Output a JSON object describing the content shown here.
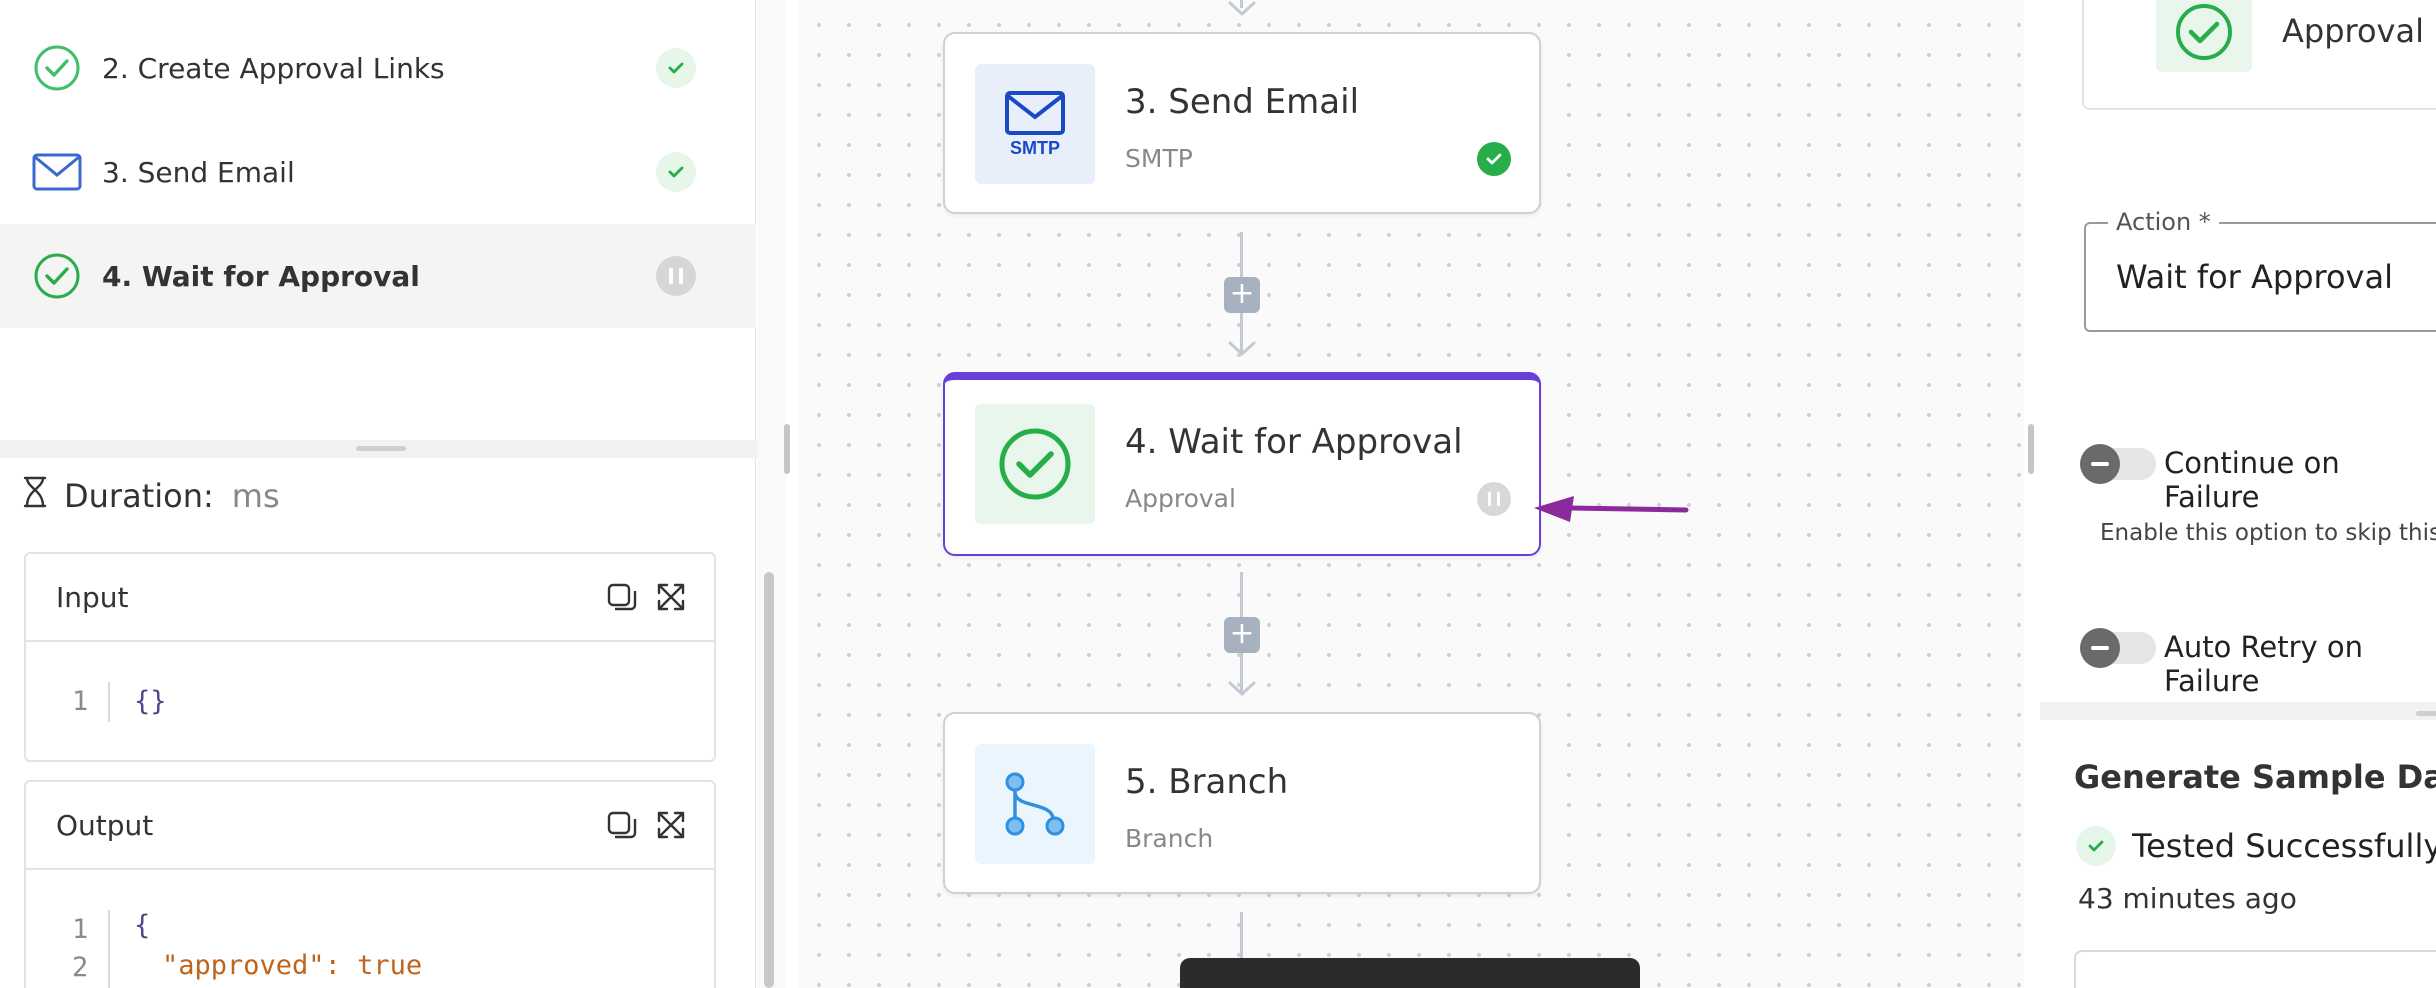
{
  "colors": {
    "success_green": "#27ae4a",
    "smtp_blue": "#1a49c6",
    "branch_blue": "#2f8fe0",
    "selected_purple": "#6a3fd8",
    "annotation_arrow": "#8b2a9a"
  },
  "steps_list": [
    {
      "label": "2. Create Approval Links",
      "icon": "check-circle-icon",
      "status": "success"
    },
    {
      "label": "3. Send Email",
      "icon": "mail-icon",
      "status": "success"
    },
    {
      "label": "4. Wait for Approval",
      "icon": "check-circle-icon",
      "status": "paused"
    }
  ],
  "run_details": {
    "duration_label": "Duration:",
    "duration_unit": "ms",
    "input": {
      "title": "Input",
      "lines": [
        {
          "num": "1",
          "text": "{}"
        }
      ]
    },
    "output": {
      "title": "Output",
      "lines": [
        {
          "num": "1",
          "text": "{"
        },
        {
          "num": "2",
          "key": "\"approved\"",
          "sep": ": ",
          "value": "true"
        }
      ]
    }
  },
  "flow": {
    "nodes": [
      {
        "title": "3. Send Email",
        "subtitle": "SMTP",
        "icon_text": "SMTP",
        "icon": "smtp-mail-icon",
        "status": "success"
      },
      {
        "title": "4. Wait for Approval",
        "subtitle": "Approval",
        "icon": "approval-check-icon",
        "status": "paused",
        "selected": true
      },
      {
        "title": "5. Branch",
        "subtitle": "Branch",
        "icon": "branch-icon"
      }
    ],
    "add_step_glyph": "+"
  },
  "settings": {
    "piece_name": "Approval",
    "action_label": "Action *",
    "action_value": "Wait for Approval",
    "continue_on_failure": "Continue on Failure",
    "continue_help": "Enable this option to skip this step and continue the flow normally if it fails.",
    "auto_retry": "Auto Retry on Failure",
    "generate_title": "Generate Sample Data",
    "tested_label": "Tested Successfully",
    "tested_time": "43 minutes ago"
  }
}
